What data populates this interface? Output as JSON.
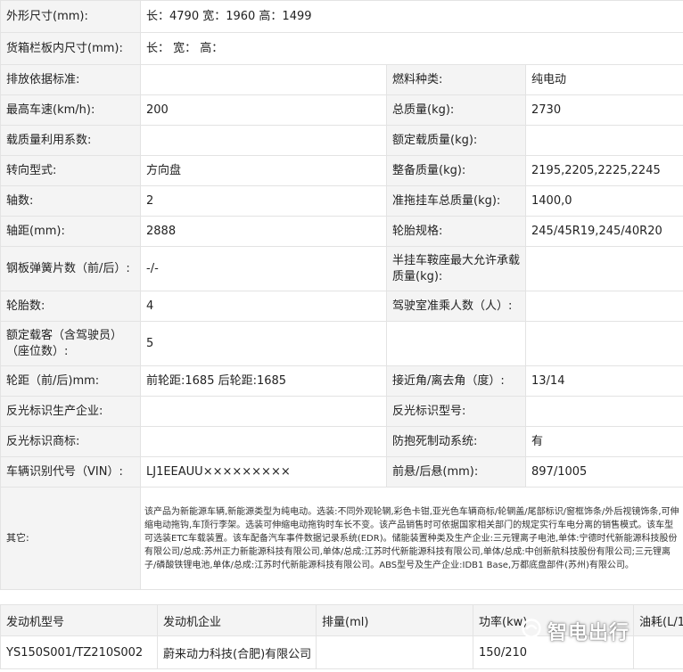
{
  "spec": {
    "dimensions": {
      "label": "外形尺寸(mm):",
      "value": "长：4790 宽：1960 高：1499"
    },
    "cargo": {
      "label": "货箱栏板内尺寸(mm):",
      "value": "长： 宽： 高："
    },
    "rows": [
      {
        "l1": "排放依据标准:",
        "v1": "",
        "l2": "燃料种类:",
        "v2": "纯电动"
      },
      {
        "l1": "最高车速(km/h):",
        "v1": "200",
        "l2": "总质量(kg):",
        "v2": "2730"
      },
      {
        "l1": "载质量利用系数:",
        "v1": "",
        "l2": "额定载质量(kg):",
        "v2": ""
      },
      {
        "l1": "转向型式:",
        "v1": "方向盘",
        "l2": "整备质量(kg):",
        "v2": "2195,2205,2225,2245"
      },
      {
        "l1": "轴数:",
        "v1": "2",
        "l2": "准拖挂车总质量(kg):",
        "v2": "1400,0"
      },
      {
        "l1": "轴距(mm):",
        "v1": "2888",
        "l2": "轮胎规格:",
        "v2": "245/45R19,245/40R20"
      },
      {
        "l1": "钢板弹簧片数（前/后）:",
        "v1": "-/-",
        "l2": "半挂车鞍座最大允许承载质量(kg):",
        "v2": ""
      },
      {
        "l1": "轮胎数:",
        "v1": "4",
        "l2": "驾驶室准乘人数（人）:",
        "v2": ""
      },
      {
        "l1": "额定载客（含驾驶员）（座位数）:",
        "v1": "5",
        "l2": "",
        "v2": ""
      },
      {
        "l1": "轮距（前/后)mm:",
        "v1": "前轮距:1685 后轮距:1685",
        "l2": "接近角/离去角（度）:",
        "v2": "13/14"
      },
      {
        "l1": "反光标识生产企业:",
        "v1": "",
        "l2": "反光标识型号:",
        "v2": ""
      },
      {
        "l1": "反光标识商标:",
        "v1": "",
        "l2": "防抱死制动系统:",
        "v2": "有"
      },
      {
        "l1": "车辆识别代号（VIN）:",
        "v1": "LJ1EEAUU×××××××××",
        "l2": "前悬/后悬(mm):",
        "v2": "897/1005"
      }
    ],
    "other": {
      "label": "其它:",
      "text": "该产品为新能源车辆,新能源类型为纯电动。选装:不同外观轮辋,彩色卡钳,亚光色车辆商标/轮辋盖/尾部标识/窗框饰条/外后视镜饰条,可伸缩电动拖钩,车顶行李架。选装可伸缩电动拖钩时车长不变。该产品销售时可依据国家相关部门的规定实行车电分离的销售模式。该车型可选装ETC车载装置。该车配备汽车事件数据记录系统(EDR)。储能装置种类及生产企业:三元锂离子电池,单体:宁德时代新能源科技股份有限公司/总成:苏州正力新能源科技有限公司,单体/总成:江苏时代新能源科技有限公司,单体/总成:中创新航科技股份有限公司;三元锂离子/磷酸铁锂电池,单体/总成:江苏时代新能源科技有限公司。ABS型号及生产企业:IDB1 Base,万都底盘部件(苏州)有限公司。"
    }
  },
  "engine_table": {
    "headers": [
      "发动机型号",
      "发动机企业",
      "排量(ml)",
      "功率(kw)",
      "油耗(L/1"
    ],
    "rows": [
      [
        "YS150S001/TZ210S002",
        "蔚来动力科技(合肥)有限公司",
        "",
        "150/210",
        ""
      ]
    ]
  },
  "watermark": {
    "text": "智电出行",
    "icon": "zhidian-logo-icon"
  }
}
